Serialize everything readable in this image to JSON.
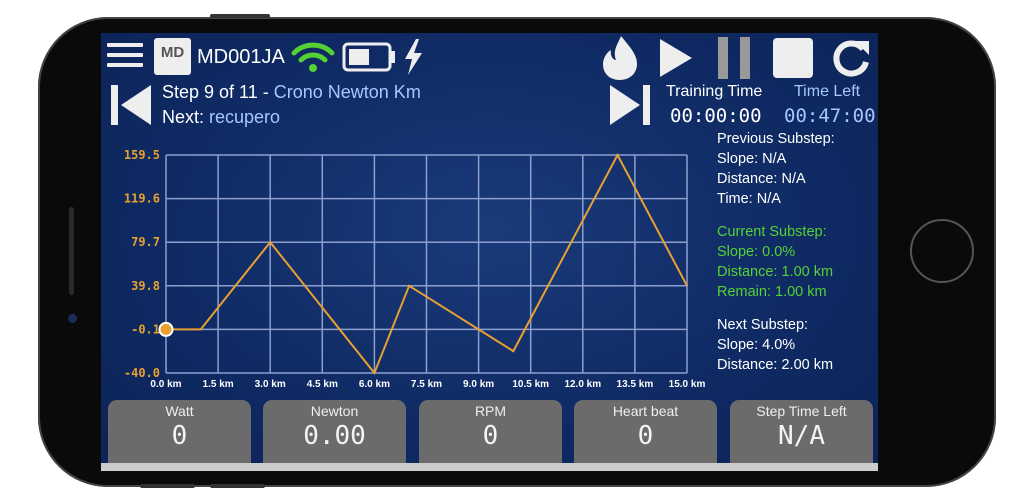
{
  "header": {
    "device_id": "MD001JA",
    "logo_text": "MD MAGNETICDAYS",
    "icons": [
      "menu-icon",
      "wifi-icon",
      "battery-icon",
      "charging-bolt-icon",
      "flame-icon",
      "play-icon",
      "pause-icon",
      "stop-icon",
      "refresh-icon",
      "skip-previous-icon",
      "skip-next-icon"
    ],
    "wifi_color": "#56d135"
  },
  "step": {
    "prefix": "Step 9 of 11 - ",
    "name": "Crono Newton Km",
    "next_label": "Next: ",
    "next_name": "recupero"
  },
  "timers": {
    "training_label": "Training Time",
    "training_value": "00:00:00",
    "left_label": "Time Left",
    "left_value": "00:47:00"
  },
  "substeps": {
    "previous": {
      "title": "Previous Substep:",
      "slope": "Slope: N/A",
      "distance": "Distance: N/A",
      "time": "Time: N/A"
    },
    "current": {
      "title": "Current Substep:",
      "slope": "Slope: 0.0%",
      "distance": "Distance: 1.00 km",
      "remain": "Remain: 1.00 km",
      "color": "#56d135"
    },
    "next": {
      "title": "Next Substep:",
      "slope": "Slope: 4.0%",
      "distance": "Distance: 2.00 km"
    }
  },
  "chart_data": {
    "type": "line",
    "x": [
      0,
      1,
      3,
      6,
      7,
      10,
      13,
      15
    ],
    "y": [
      -0.1,
      -0.1,
      79.7,
      -40.0,
      39.8,
      -20,
      159.5,
      39.8
    ],
    "xlim": [
      0,
      15
    ],
    "ylim": [
      -40.0,
      159.5
    ],
    "x_ticks": [
      "0.0 km",
      "1.5 km",
      "3.0 km",
      "4.5 km",
      "6.0 km",
      "7.5 km",
      "9.0 km",
      "10.5 km",
      "12.0 km",
      "13.5 km",
      "15.0 km"
    ],
    "y_ticks": [
      "159.5",
      "119.6",
      "79.7",
      "39.8",
      "-0.1",
      "-40.0"
    ],
    "grid": true,
    "line_color": "#e8a030",
    "current_marker": {
      "x": 0,
      "y": -0.1
    }
  },
  "metrics": [
    {
      "label": "Watt",
      "value": "0"
    },
    {
      "label": "Newton",
      "value": "0.00"
    },
    {
      "label": "RPM",
      "value": "0"
    },
    {
      "label": "Heart beat",
      "value": "0"
    },
    {
      "label": "Step Time Left",
      "value": "N/A"
    }
  ]
}
